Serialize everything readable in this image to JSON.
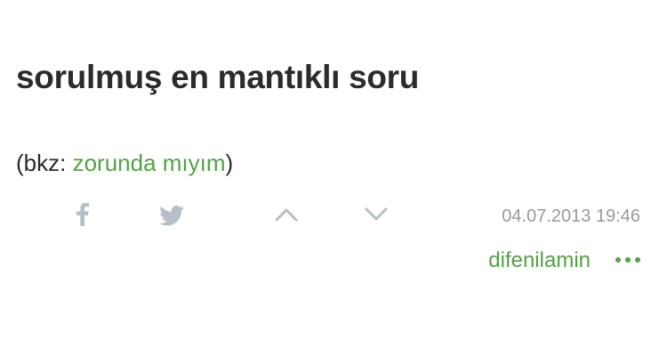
{
  "entry": {
    "title": "sorulmuş en mantıklı soru",
    "content_prefix": "(bkz: ",
    "content_link": "zorunda mıyım",
    "content_suffix": ")",
    "date": "04.07.2013 19:46",
    "author": "difenilamin"
  },
  "colors": {
    "text": "#2b2b2b",
    "accent": "#53a245",
    "icon": "#b6bfc6",
    "muted": "#9a9a9a"
  },
  "icons": [
    "facebook-icon",
    "twitter-icon",
    "upvote-icon",
    "downvote-icon",
    "more-options-icon"
  ]
}
